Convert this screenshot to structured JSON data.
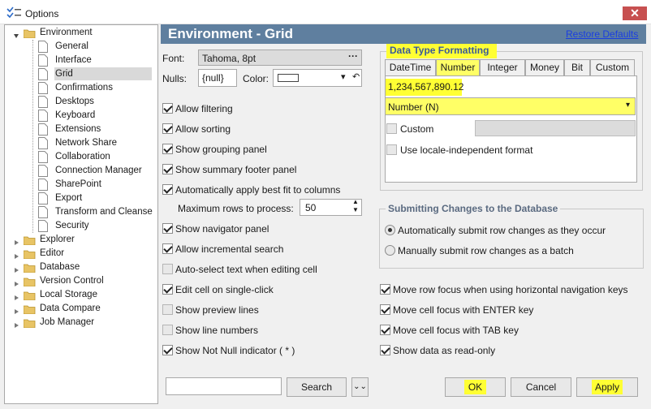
{
  "window": {
    "title": "Options",
    "close_glyph": "✕"
  },
  "tree": {
    "items": [
      {
        "label": "Environment",
        "level": 0,
        "type": "folder",
        "expanded": true
      },
      {
        "label": "General",
        "level": 1,
        "type": "page"
      },
      {
        "label": "Interface",
        "level": 1,
        "type": "page"
      },
      {
        "label": "Grid",
        "level": 1,
        "type": "page",
        "selected": true
      },
      {
        "label": "Confirmations",
        "level": 1,
        "type": "page"
      },
      {
        "label": "Desktops",
        "level": 1,
        "type": "page"
      },
      {
        "label": "Keyboard",
        "level": 1,
        "type": "page"
      },
      {
        "label": "Extensions",
        "level": 1,
        "type": "page"
      },
      {
        "label": "Network Share",
        "level": 1,
        "type": "page"
      },
      {
        "label": "Collaboration",
        "level": 1,
        "type": "page"
      },
      {
        "label": "Connection Manager",
        "level": 1,
        "type": "page"
      },
      {
        "label": "SharePoint",
        "level": 1,
        "type": "page"
      },
      {
        "label": "Export",
        "level": 1,
        "type": "page"
      },
      {
        "label": "Transform and Cleanse",
        "level": 1,
        "type": "page"
      },
      {
        "label": "Security",
        "level": 1,
        "type": "page"
      },
      {
        "label": "Explorer",
        "level": 0,
        "type": "folder"
      },
      {
        "label": "Editor",
        "level": 0,
        "type": "folder"
      },
      {
        "label": "Database",
        "level": 0,
        "type": "folder"
      },
      {
        "label": "Version Control",
        "level": 0,
        "type": "folder"
      },
      {
        "label": "Local Storage",
        "level": 0,
        "type": "folder"
      },
      {
        "label": "Data Compare",
        "level": 0,
        "type": "folder"
      },
      {
        "label": "Job Manager",
        "level": 0,
        "type": "folder"
      }
    ]
  },
  "header": {
    "title": "Environment - Grid",
    "restore_label": "Restore Defaults"
  },
  "font": {
    "label": "Font:",
    "value": "Tahoma, 8pt",
    "browse": "···"
  },
  "nulls": {
    "label": "Nulls:",
    "value": "{null}",
    "color_label": "Color:"
  },
  "options_left": [
    {
      "label": "Allow filtering",
      "checked": true
    },
    {
      "label": "Allow sorting",
      "checked": true
    },
    {
      "label": "Show grouping panel",
      "checked": true
    },
    {
      "label": "Show summary footer panel",
      "checked": true
    },
    {
      "label": "Automatically apply best fit to columns",
      "checked": true
    },
    {
      "label": "Show navigator panel",
      "checked": true
    },
    {
      "label": "Allow incremental search",
      "checked": true
    },
    {
      "label": "Auto-select text when editing cell",
      "checked": false
    },
    {
      "label": "Edit cell on single-click",
      "checked": true
    },
    {
      "label": "Show preview lines",
      "checked": false
    },
    {
      "label": "Show line numbers",
      "checked": false
    },
    {
      "label": "Show Not Null indicator ( * )",
      "checked": true
    }
  ],
  "max_rows": {
    "label": "Maximum rows to process:",
    "value": "50"
  },
  "formatting": {
    "title": "Data Type Formatting",
    "tabs": [
      "DateTime",
      "Number",
      "Integer",
      "Money",
      "Bit",
      "Custom"
    ],
    "active_tab": "Number",
    "sample": "1,234,567,890.12",
    "format_select": "Number (N)",
    "custom_label": "Custom",
    "custom_checked": false,
    "locale_label": "Use locale-independent format",
    "locale_checked": false
  },
  "submit": {
    "title": "Submitting Changes to the Database",
    "auto_label": "Automatically submit row changes as they occur",
    "manual_label": "Manually submit row changes as a batch",
    "auto_selected": true
  },
  "options_right": [
    {
      "label": "Move row focus when using horizontal navigation keys",
      "checked": true
    },
    {
      "label": "Move cell focus with ENTER key",
      "checked": true
    },
    {
      "label": "Move cell focus with TAB key",
      "checked": true
    },
    {
      "label": "Show data as read-only",
      "checked": true
    }
  ],
  "footer": {
    "search_placeholder": "",
    "search_label": "Search",
    "ok": "OK",
    "cancel": "Cancel",
    "apply": "Apply"
  },
  "colors": {
    "header": "#5f7f9f",
    "highlight": "#ffff33",
    "link": "#1a3ee0"
  }
}
